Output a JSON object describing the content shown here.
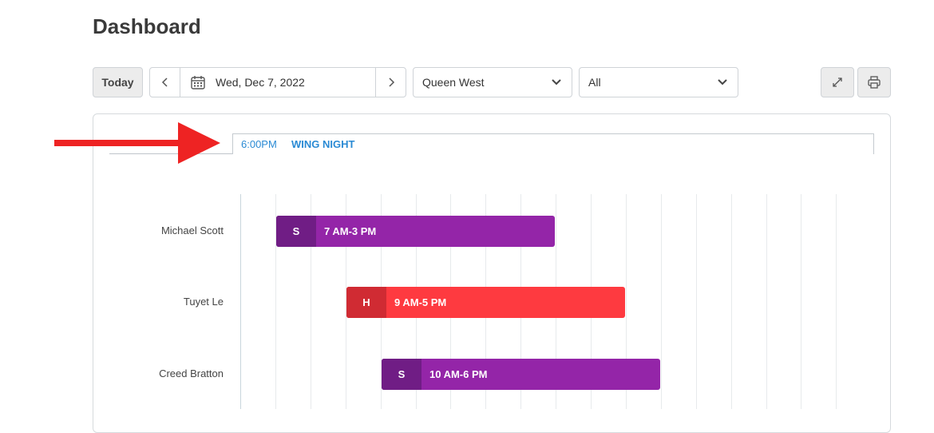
{
  "page": {
    "title": "Dashboard"
  },
  "toolbar": {
    "today_label": "Today",
    "date": "Wed, Dec 7, 2022",
    "location": "Queen West",
    "filter": "All",
    "icons": {
      "prev": "chevron-left-icon",
      "next": "chevron-right-icon",
      "calendar": "calendar-icon",
      "expand": "expand-icon",
      "print": "print-icon",
      "dropdown": "chevron-down-icon"
    }
  },
  "event": {
    "time": "6:00PM",
    "name": "WING NIGHT"
  },
  "schedule": {
    "rows": [
      {
        "name": "Michael Scott",
        "role": "S",
        "time": "7 AM-3 PM",
        "color": "#9425a8"
      },
      {
        "name": "Tuyet Le",
        "role": "H",
        "time": "9 AM-5 PM",
        "color": "#fe3a40"
      },
      {
        "name": "Creed Bratton",
        "role": "S",
        "time": "10 AM-6 PM",
        "color": "#9425a8"
      }
    ]
  },
  "colors": {
    "accent_blue": "#2a8ad4",
    "server_purple": "#9425a8",
    "host_red": "#fe3a40",
    "annotation_arrow": "#ee2323"
  }
}
